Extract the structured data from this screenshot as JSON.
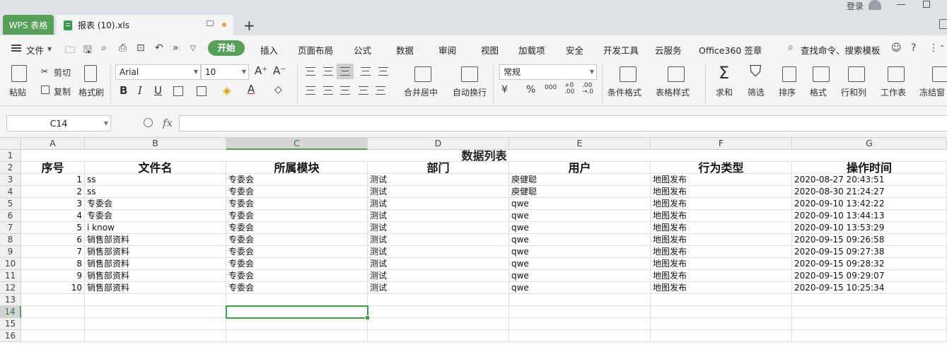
{
  "titlebar": {
    "app_tab": "WPS 表格",
    "doc_tab": "报表 (10).xls",
    "new_tab": "+",
    "login": "登录"
  },
  "menu": {
    "file": "文件",
    "items": [
      "开始",
      "插入",
      "页面布局",
      "公式",
      "数据",
      "审阅",
      "视图",
      "加载项",
      "安全",
      "开发工具",
      "云服务",
      "Office360 签章"
    ],
    "search": "查找命令、搜索模板"
  },
  "ribbon": {
    "paste": "粘贴",
    "cut": "剪切",
    "copy": "复制",
    "format_painter": "格式刷",
    "font_name": "Arial",
    "font_size": "10",
    "merge_center": "合并居中",
    "wrap_text": "自动换行",
    "number_format": "常规",
    "conditional_format": "条件格式",
    "table_style": "表格样式",
    "sum": "求和",
    "filter": "筛选",
    "sort": "排序",
    "format": "格式",
    "row_col": "行和列",
    "worksheet": "工作表",
    "freeze": "冻结窗"
  },
  "formula_bar": {
    "name_box": "C14",
    "fx": "fx",
    "content": ""
  },
  "sheet": {
    "columns": [
      "A",
      "B",
      "C",
      "D",
      "E",
      "F",
      "G"
    ],
    "rows": [
      "1",
      "2",
      "3",
      "4",
      "5",
      "6",
      "7",
      "8",
      "9",
      "10",
      "11",
      "12",
      "13",
      "14",
      "15",
      "16"
    ],
    "title": "数据列表",
    "headers": [
      "序号",
      "文件名",
      "所属模块",
      "部门",
      "用户",
      "行为类型",
      "操作时间"
    ],
    "data": [
      [
        "1",
        "ss",
        "专委会",
        "测试",
        "庾健聪",
        "地图发布",
        "2020-08-27 20:43:51"
      ],
      [
        "2",
        "ss",
        "专委会",
        "测试",
        "庾健聪",
        "地图发布",
        "2020-08-30 21:24:27"
      ],
      [
        "3",
        "专委会",
        "专委会",
        "测试",
        "qwe",
        "地图发布",
        "2020-09-10 13:42:22"
      ],
      [
        "4",
        "专委会",
        "专委会",
        "测试",
        "qwe",
        "地图发布",
        "2020-09-10 13:44:13"
      ],
      [
        "5",
        "i know",
        "专委会",
        "测试",
        "qwe",
        "地图发布",
        "2020-09-10 13:53:29"
      ],
      [
        "6",
        "销售部资料",
        "专委会",
        "测试",
        "qwe",
        "地图发布",
        "2020-09-15 09:26:58"
      ],
      [
        "7",
        "销售部资料",
        "专委会",
        "测试",
        "qwe",
        "地图发布",
        "2020-09-15 09:27:38"
      ],
      [
        "8",
        "销售部资料",
        "专委会",
        "测试",
        "qwe",
        "地图发布",
        "2020-09-15 09:28:32"
      ],
      [
        "9",
        "销售部资料",
        "专委会",
        "测试",
        "qwe",
        "地图发布",
        "2020-09-15 09:29:07"
      ],
      [
        "10",
        "销售部资料",
        "专委会",
        "测试",
        "qwe",
        "地图发布",
        "2020-09-15 10:25:34"
      ]
    ],
    "selected_cell": "C14"
  },
  "colors": {
    "accent": "#57a05a",
    "selection": "#3aa140",
    "tab_dot": "#f39d3a"
  }
}
